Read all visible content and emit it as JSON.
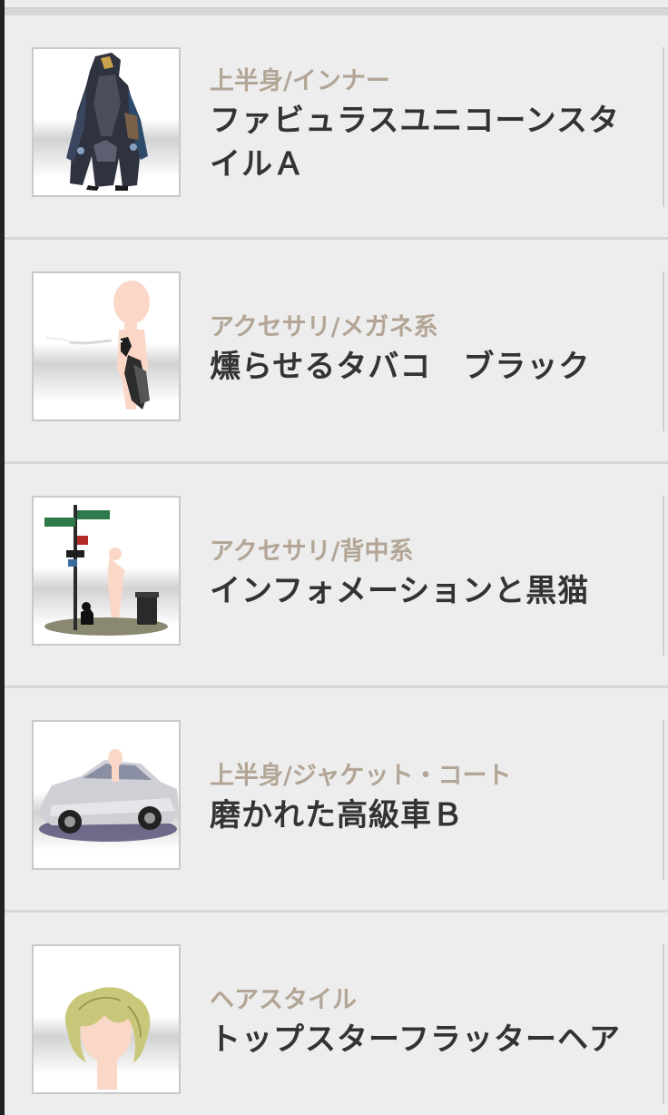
{
  "items": [
    {
      "category": "上半身/インナー",
      "name": "ファビュラスユニコーンスタイルＡ",
      "thumbnail_icon": "unicorn-costume-thumbnail"
    },
    {
      "category": "アクセサリ/メガネ系",
      "name": "燻らせるタバコ　ブラック",
      "thumbnail_icon": "cigarette-thumbnail"
    },
    {
      "category": "アクセサリ/背中系",
      "name": "インフォメーションと黒猫",
      "thumbnail_icon": "street-sign-cat-thumbnail"
    },
    {
      "category": "上半身/ジャケット・コート",
      "name": "磨かれた高級車Ｂ",
      "thumbnail_icon": "luxury-car-thumbnail"
    },
    {
      "category": "ヘアスタイル",
      "name": "トップスターフラッターヘア",
      "thumbnail_icon": "blonde-hair-thumbnail"
    }
  ],
  "colors": {
    "category_text": "#b3a596",
    "name_text": "#333333",
    "row_background": "#ededed",
    "separator": "#d6d6d6"
  }
}
